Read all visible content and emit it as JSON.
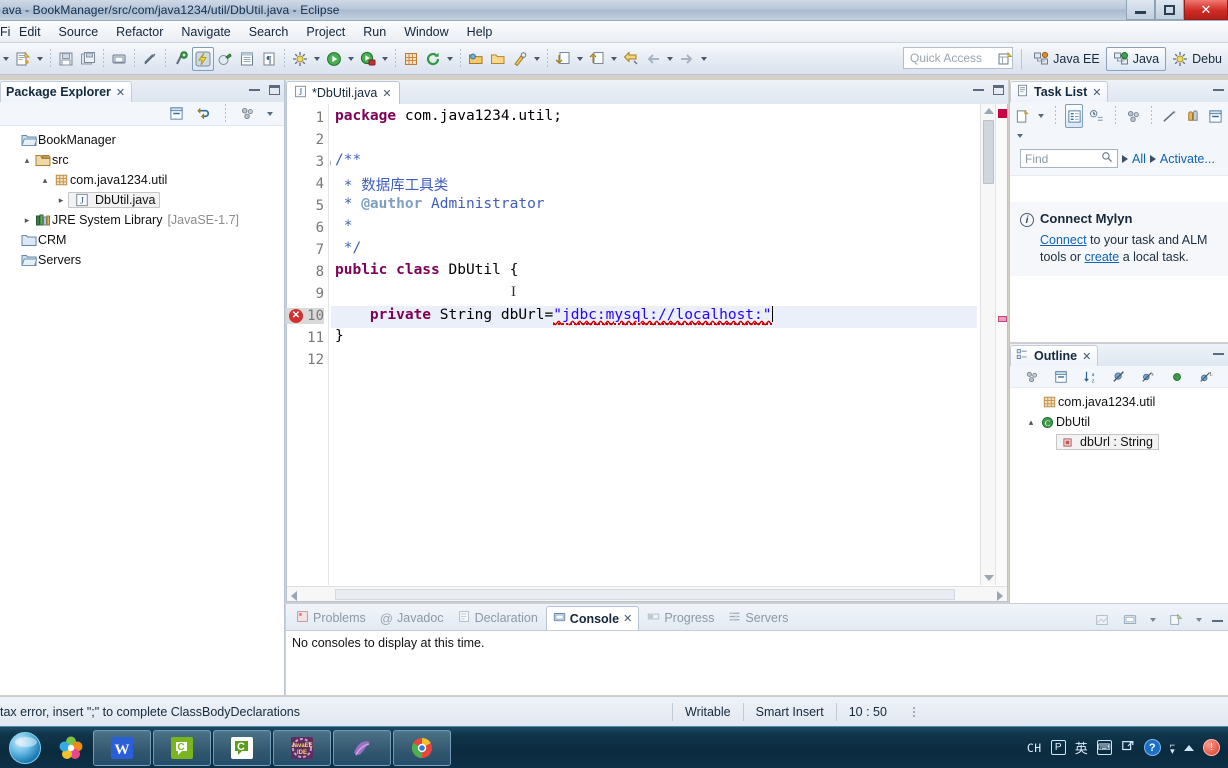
{
  "window": {
    "title": "ava - BookManager/src/com/java1234/util/DbUtil.java - Eclipse",
    "minimize_label": "",
    "maximize_label": "",
    "close_label": "✕"
  },
  "menu": {
    "items": [
      {
        "label": "File",
        "clipped": true
      },
      {
        "label": "Edit"
      },
      {
        "label": "Source"
      },
      {
        "label": "Refactor"
      },
      {
        "label": "Navigate"
      },
      {
        "label": "Search"
      },
      {
        "label": "Project"
      },
      {
        "label": "Run"
      },
      {
        "label": "Window"
      },
      {
        "label": "Help"
      }
    ]
  },
  "toolbar": {
    "quick_access_placeholder": "Quick Access",
    "perspectives": [
      {
        "label": "Java EE",
        "active": false,
        "icon": "java-ee-perspective-icon"
      },
      {
        "label": "Java",
        "active": true,
        "icon": "java-perspective-icon"
      },
      {
        "label": "Debu",
        "active": false,
        "icon": "debug-perspective-icon"
      }
    ],
    "buttons": [
      "new-wizard-icon",
      "save-icon",
      "save-all-icon",
      "print-icon",
      "toggle-mark-occurrences-icon",
      "skip-breakpoints-icon",
      "run-last-tool-icon",
      "external-tools-icon",
      "open-type-icon",
      "toggle-whitespace-icon",
      "build-icon",
      "run-icon",
      "debug-icon",
      "coverage-icon",
      "refresh-icon",
      "open-resource-icon",
      "search-icon",
      "next-annotation-icon",
      "prev-annotation-icon",
      "last-edit-location-icon",
      "back-icon",
      "forward-icon"
    ]
  },
  "package_explorer": {
    "title": "Package Explorer",
    "close_label": "✕",
    "toolbar_icons": [
      "collapse-all-icon",
      "link-with-editor-icon",
      "view-menu-focus-icon",
      "view-menu-icon"
    ],
    "tree": [
      {
        "label": "BookManager",
        "indent": 0,
        "arrow": "",
        "icon": "project-folder-icon",
        "selected": false
      },
      {
        "label": "src",
        "indent": 1,
        "arrow": "▴",
        "icon": "source-folder-icon",
        "selected": false
      },
      {
        "label": "com.java1234.util",
        "indent": 2,
        "arrow": "▴",
        "icon": "package-icon",
        "selected": false
      },
      {
        "label": "DbUtil.java",
        "indent": 3,
        "arrow": "▸",
        "icon": "java-file-icon",
        "selected": true
      },
      {
        "label": "JRE System Library",
        "suffix": "[JavaSE-1.7]",
        "indent": 1,
        "arrow": "▸",
        "icon": "library-icon",
        "selected": false
      },
      {
        "label": "CRM",
        "indent": 0,
        "arrow": "",
        "icon": "closed-project-icon",
        "selected": false
      },
      {
        "label": "Servers",
        "indent": 0,
        "arrow": "",
        "icon": "project-folder-icon",
        "selected": false
      }
    ]
  },
  "editor": {
    "tab_label": "*DbUtil.java",
    "tab_icon": "java-file-icon",
    "close_label": "✕",
    "dirty": true,
    "lines": [
      {
        "n": 1,
        "type": "code",
        "text": "package com.java1234.util;"
      },
      {
        "n": 2,
        "type": "blank",
        "text": ""
      },
      {
        "n": 3,
        "type": "javadoc",
        "text": "/**",
        "fold": true
      },
      {
        "n": 4,
        "type": "javadoc",
        "text": " * 数据库工具类"
      },
      {
        "n": 5,
        "type": "javadoc",
        "text": " * @author Administrator"
      },
      {
        "n": 6,
        "type": "javadoc",
        "text": " *"
      },
      {
        "n": 7,
        "type": "javadoc",
        "text": " */"
      },
      {
        "n": 8,
        "type": "code",
        "text": "public class DbUtil {"
      },
      {
        "n": 9,
        "type": "blank",
        "text": ""
      },
      {
        "n": 10,
        "type": "code",
        "text": "    private String dbUrl=\"jdbc:mysql://localhost:\"",
        "error": true,
        "current": true
      },
      {
        "n": 11,
        "type": "code",
        "text": "}"
      },
      {
        "n": 12,
        "type": "blank",
        "text": ""
      }
    ],
    "error_marker": "error-marker-icon"
  },
  "task_list": {
    "title": "Task List",
    "close_label": "✕",
    "toolbar_icons": [
      "new-task-icon",
      "categorized-presentation-icon",
      "scheduled-presentation-icon",
      "synchronize-icon",
      "focus-on-workweek-icon",
      "show-ui-legend-icon",
      "collapse-all-icon",
      "view-menu-icon"
    ],
    "find_placeholder": "Find",
    "search_icon": "search-icon",
    "filters": [
      {
        "label": "All"
      },
      {
        "label": "Activate..."
      }
    ],
    "mylyn": {
      "heading": "Connect Mylyn",
      "info_icon": "info-icon",
      "link1": "Connect",
      "body1": " to your task and ALM tools or ",
      "link2": "create",
      "body2": " a local task."
    }
  },
  "outline": {
    "title": "Outline",
    "close_label": "✕",
    "toolbar_icons": [
      "focus-on-active-task-icon",
      "collapse-all-icon",
      "sort-icon",
      "hide-fields-icon",
      "hide-static-icon",
      "hide-public-icon",
      "hide-local-types-icon"
    ],
    "tree": [
      {
        "label": "com.java1234.util",
        "indent": 1,
        "arrow": "",
        "icon": "package-icon"
      },
      {
        "label": "DbUtil",
        "indent": 0,
        "arrow": "▴",
        "icon": "class-icon"
      },
      {
        "label": "dbUrl : String",
        "indent": 2,
        "arrow": "",
        "icon": "private-field-icon",
        "selected": true
      }
    ]
  },
  "console": {
    "tabs": [
      {
        "label": "Problems",
        "icon": "problems-icon",
        "active": false
      },
      {
        "label": "Javadoc",
        "icon": "javadoc-icon",
        "active": false
      },
      {
        "label": "Declaration",
        "icon": "declaration-icon",
        "active": false
      },
      {
        "label": "Console",
        "icon": "console-icon",
        "active": true,
        "close_label": "✕"
      },
      {
        "label": "Progress",
        "icon": "progress-icon",
        "active": false
      },
      {
        "label": "Servers",
        "icon": "servers-icon",
        "active": false
      }
    ],
    "message": "No consoles to display at this time.",
    "toolbar_icons": [
      "clear-console-icon",
      "display-selected-console-icon",
      "open-console-icon",
      "minimize-icon"
    ]
  },
  "status_bar": {
    "message": "tax error, insert \";\" to complete ClassBodyDeclarations",
    "writable": "Writable",
    "insert_mode": "Smart Insert",
    "position": "10 : 50"
  },
  "taskbar": {
    "start_icon": "windows-start-orb",
    "quick_launch": [
      "flower-app-icon"
    ],
    "items": [
      {
        "icon": "word-icon",
        "label": "W"
      },
      {
        "icon": "wechat-green-icon",
        "label": "C"
      },
      {
        "icon": "wechat-white-icon",
        "label": "C"
      },
      {
        "icon": "eclipse-javaee-icon",
        "label": "Java EE IDE"
      },
      {
        "icon": "navicat-icon",
        "label": ""
      },
      {
        "icon": "chrome-icon",
        "label": ""
      }
    ],
    "tray": {
      "lang": "CH",
      "ime_mode": "P",
      "ime_lang": "英",
      "icons": [
        "ime-keyboard-icon",
        "ime-tools-icon",
        "help-icon",
        "ime-expand-icon",
        "show-hidden-icons-icon",
        "notification-icon"
      ]
    }
  },
  "colors": {
    "accent": "#0e62b8",
    "error": "#cc0000",
    "keyword": "#7f0055",
    "string": "#2a00ff",
    "javadoc": "#3f5fbf",
    "javadoc_tag": "#7f9fbf",
    "taskbar": "#0b2b3e"
  }
}
